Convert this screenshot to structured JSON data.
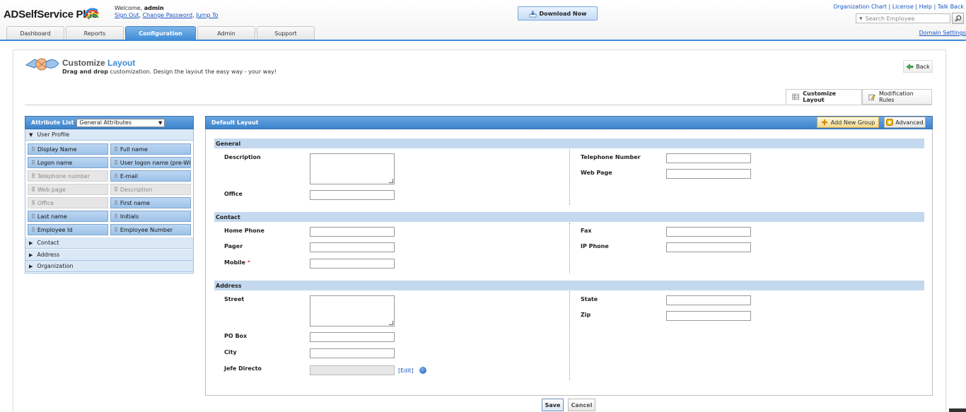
{
  "app": {
    "name": "ADSelfService Plus",
    "welcome_prefix": "Welcome,",
    "username": "admin",
    "links": [
      "Sign Out",
      "Change Password",
      "Jump To"
    ],
    "download_label": "Download Now",
    "top_links": [
      "Organization Chart",
      "License",
      "Help",
      "Talk Back"
    ],
    "search_placeholder": "Search Employee",
    "domain_settings": "Domain Settings"
  },
  "tabs": [
    {
      "label": "Dashboard",
      "active": false
    },
    {
      "label": "Reports",
      "active": false
    },
    {
      "label": "Configuration",
      "active": true
    },
    {
      "label": "Admin",
      "active": false
    },
    {
      "label": "Support",
      "active": false
    }
  ],
  "page": {
    "title_part1": "Customize",
    "title_part2": "Layout",
    "subtitle_bold": "Drag and drop",
    "subtitle_rest": "customization. Design the layout the easy way - your way!",
    "back_label": "Back",
    "subtabs": [
      {
        "label": "Customize Layout",
        "active": true,
        "icon": "grid-icon"
      },
      {
        "label": "Modification Rules",
        "active": false,
        "icon": "pencil-icon"
      }
    ]
  },
  "attribute_list": {
    "title": "Attribute List",
    "selected": "General Attributes",
    "expanded_group": "User Profile",
    "items": [
      {
        "label": "Display Name",
        "enabled": true
      },
      {
        "label": "Full name",
        "enabled": true
      },
      {
        "label": "Logon name",
        "enabled": true
      },
      {
        "label": "User logon name (pre-Wi",
        "enabled": true
      },
      {
        "label": "Telephone number",
        "enabled": false
      },
      {
        "label": "E-mail",
        "enabled": true
      },
      {
        "label": "Web page",
        "enabled": false
      },
      {
        "label": "Description",
        "enabled": false
      },
      {
        "label": "Office",
        "enabled": false
      },
      {
        "label": "First name",
        "enabled": true
      },
      {
        "label": "Last name",
        "enabled": true
      },
      {
        "label": "Initials",
        "enabled": true
      },
      {
        "label": "Employee Id",
        "enabled": true
      },
      {
        "label": "Employee Number",
        "enabled": true
      }
    ],
    "collapsed_groups": [
      "Contact",
      "Address",
      "Organization"
    ]
  },
  "layout": {
    "title": "Default Layout",
    "add_group_label": "Add New Group",
    "advanced_label": "Advanced",
    "sections": {
      "general": {
        "title": "General",
        "description": "Description",
        "office": "Office",
        "telephone": "Telephone Number",
        "web_page": "Web Page"
      },
      "contact": {
        "title": "Contact",
        "home_phone": "Home Phone",
        "pager": "Pager",
        "mobile": "Mobile",
        "fax": "Fax",
        "ip_phone": "IP Phone"
      },
      "address": {
        "title": "Address",
        "street": "Street",
        "po_box": "PO Box",
        "city": "City",
        "jefe_directo": "Jefe Directo",
        "edit_link": "[Edit]",
        "state": "State",
        "zip": "Zip"
      }
    }
  },
  "actions": {
    "save": "Save",
    "cancel": "Cancel"
  },
  "colors": {
    "accent": "#3e8cd7",
    "section_bar": "#c4d9ef",
    "link": "#1a54c4"
  }
}
